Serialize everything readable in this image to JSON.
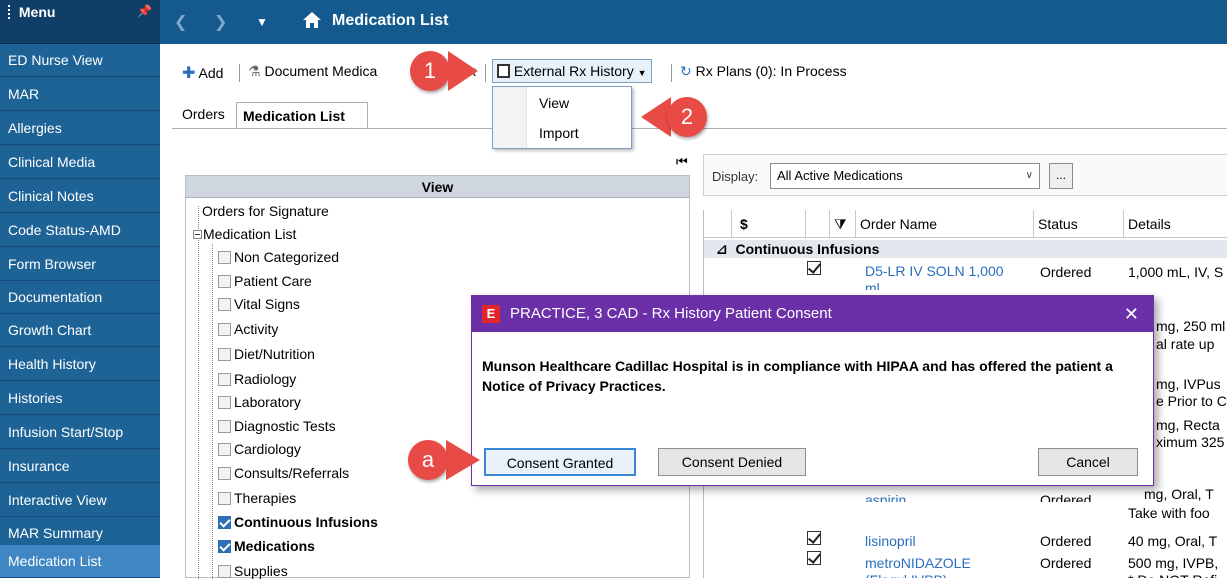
{
  "sidebar": {
    "title": "Menu",
    "items": [
      {
        "label": "ED Nurse View"
      },
      {
        "label": "MAR"
      },
      {
        "label": "Allergies"
      },
      {
        "label": "Clinical Media"
      },
      {
        "label": "Clinical Notes"
      },
      {
        "label": "Code Status-AMD"
      },
      {
        "label": "Form Browser"
      },
      {
        "label": "Documentation"
      },
      {
        "label": "Growth Chart"
      },
      {
        "label": "Health History"
      },
      {
        "label": "Histories"
      },
      {
        "label": "Infusion Start/Stop"
      },
      {
        "label": "Insurance"
      },
      {
        "label": "Interactive View"
      },
      {
        "label": "MAR Summary"
      },
      {
        "label": "Medication List",
        "active": true
      }
    ]
  },
  "header": {
    "title": "Medication List"
  },
  "toolbar": {
    "add": "Add",
    "document_med": "Document Medica",
    "hidden_fragment": "x",
    "external_rx": "External Rx History",
    "rx_plans": "Rx Plans (0): In Process"
  },
  "dropdown": {
    "items": [
      "View",
      "Import"
    ]
  },
  "tabs": [
    {
      "label": "Orders"
    },
    {
      "label": "Medication List",
      "active": true
    }
  ],
  "view_panel": {
    "header": "View",
    "orders_for_signature": "Orders for Signature",
    "medication_list": "Medication List",
    "categories": [
      {
        "label": "Non Categorized",
        "checked": false
      },
      {
        "label": "Patient Care",
        "checked": false
      },
      {
        "label": "Vital Signs",
        "checked": false
      },
      {
        "label": "Activity",
        "checked": false
      },
      {
        "label": "Diet/Nutrition",
        "checked": false
      },
      {
        "label": "Radiology",
        "checked": false
      },
      {
        "label": "Laboratory",
        "checked": false
      },
      {
        "label": "Diagnostic Tests",
        "checked": false
      },
      {
        "label": "Cardiology",
        "checked": false
      },
      {
        "label": "Consults/Referrals",
        "checked": false
      },
      {
        "label": "Therapies",
        "checked": false
      },
      {
        "label": "Continuous Infusions",
        "checked": true
      },
      {
        "label": "Medications",
        "checked": true
      },
      {
        "label": "Supplies",
        "checked": false
      }
    ]
  },
  "display": {
    "label": "Display:",
    "value": "All Active Medications",
    "more": "..."
  },
  "grid": {
    "columns": [
      "$",
      "Order Name",
      "Status",
      "Details"
    ],
    "group": "Continuous Infusions",
    "rows_top": [
      {
        "name": "D5-LR IV SOLN 1,000",
        "name2": "ml",
        "status": "Ordered",
        "details": "1,000 mL, IV, S"
      }
    ],
    "partial_details": [
      "mg, 250 ml",
      "al rate up",
      "mg, IVPus",
      "e Prior to C",
      "mg, Recta",
      "ximum 325",
      "mg, Oral, T",
      "Take with foo"
    ],
    "partial_row": {
      "name": "aspirin",
      "status": "Ordered"
    },
    "rows_bottom": [
      {
        "name": "lisinopril",
        "status": "Ordered",
        "details": "40 mg, Oral, T"
      },
      {
        "name": "metroNIDAZOLE",
        "name2": "(Flagyl IVPB)",
        "status": "Ordered",
        "details": "500 mg, IVPB,",
        "details2": "* Do NOT Refi"
      }
    ]
  },
  "dialog": {
    "title": "PRACTICE, 3 CAD - Rx History Patient Consent",
    "message": "Munson Healthcare Cadillac Hospital is in compliance with HIPAA and has offered the patient a Notice of Privacy Practices.",
    "granted": "Consent Granted",
    "denied": "Consent Denied",
    "cancel": "Cancel"
  },
  "callouts": {
    "one": "1",
    "two": "2",
    "a": "a"
  },
  "colors": {
    "sidebar": "#1e6396",
    "topbar": "#145a8e",
    "dialog_title": "#6b2fa8",
    "callout": "#e84a45",
    "link": "#2a6ebd"
  }
}
